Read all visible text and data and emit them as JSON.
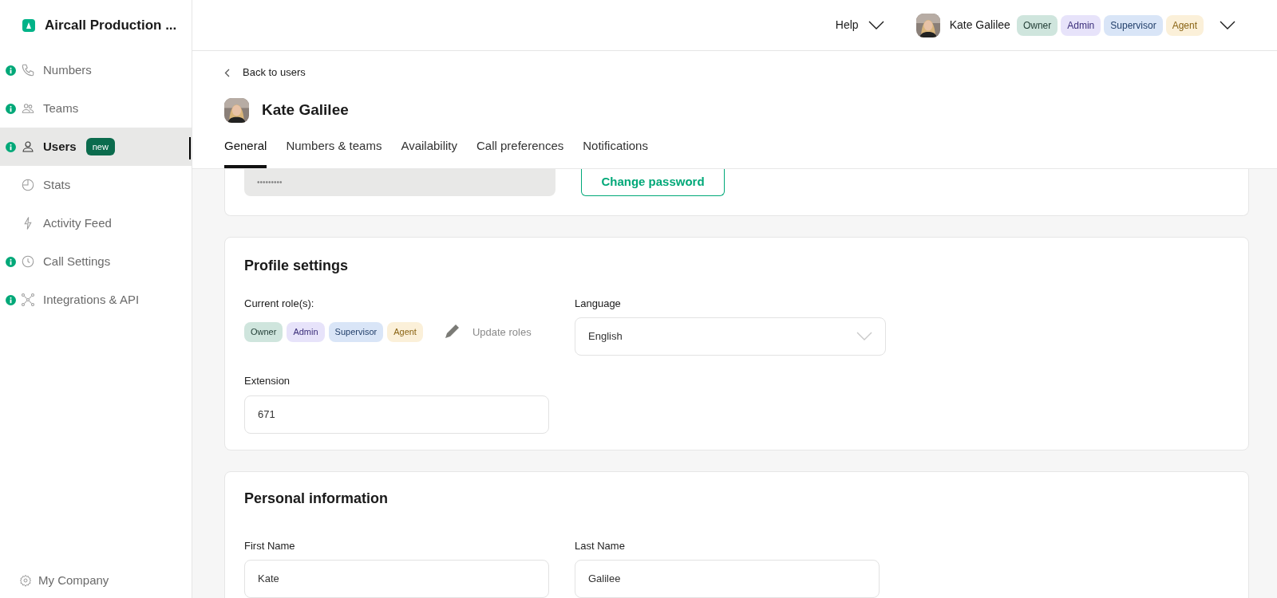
{
  "sidebar": {
    "workspace": "Aircall Production ...",
    "items": [
      {
        "label": "Numbers",
        "info": true,
        "selected": false
      },
      {
        "label": "Teams",
        "info": true,
        "selected": false
      },
      {
        "label": "Users",
        "info": true,
        "selected": true,
        "badge": "new"
      },
      {
        "label": "Stats",
        "info": false,
        "selected": false
      },
      {
        "label": "Activity Feed",
        "info": false,
        "selected": false
      },
      {
        "label": "Call Settings",
        "info": true,
        "selected": false
      },
      {
        "label": "Integrations & API",
        "info": true,
        "selected": false
      }
    ],
    "footer": "My Company"
  },
  "topbar": {
    "help": "Help",
    "user": "Kate Galilee",
    "roles": [
      {
        "label": "Owner",
        "kind": "owner"
      },
      {
        "label": "Admin",
        "kind": "admin"
      },
      {
        "label": "Supervisor",
        "kind": "supervisor"
      },
      {
        "label": "Agent",
        "kind": "agent"
      }
    ]
  },
  "back_link": "Back to users",
  "user_name": "Kate Galilee",
  "tabs": [
    {
      "label": "General",
      "selected": true
    },
    {
      "label": "Numbers & teams",
      "selected": false
    },
    {
      "label": "Availability",
      "selected": false
    },
    {
      "label": "Call preferences",
      "selected": false
    },
    {
      "label": "Notifications",
      "selected": false
    }
  ],
  "password": {
    "value": "•••••••••",
    "button": "Change password"
  },
  "profile": {
    "title": "Profile settings",
    "roles_label": "Current role(s):",
    "roles": [
      {
        "label": "Owner",
        "kind": "owner"
      },
      {
        "label": "Admin",
        "kind": "admin"
      },
      {
        "label": "Supervisor",
        "kind": "supervisor"
      },
      {
        "label": "Agent",
        "kind": "agent"
      }
    ],
    "update_roles": "Update roles",
    "language_label": "Language",
    "language": "English",
    "extension_label": "Extension",
    "extension": "671"
  },
  "personal": {
    "title": "Personal information",
    "first_name_label": "First Name",
    "first_name": "Kate",
    "last_name_label": "Last Name",
    "last_name": "Galilee"
  }
}
